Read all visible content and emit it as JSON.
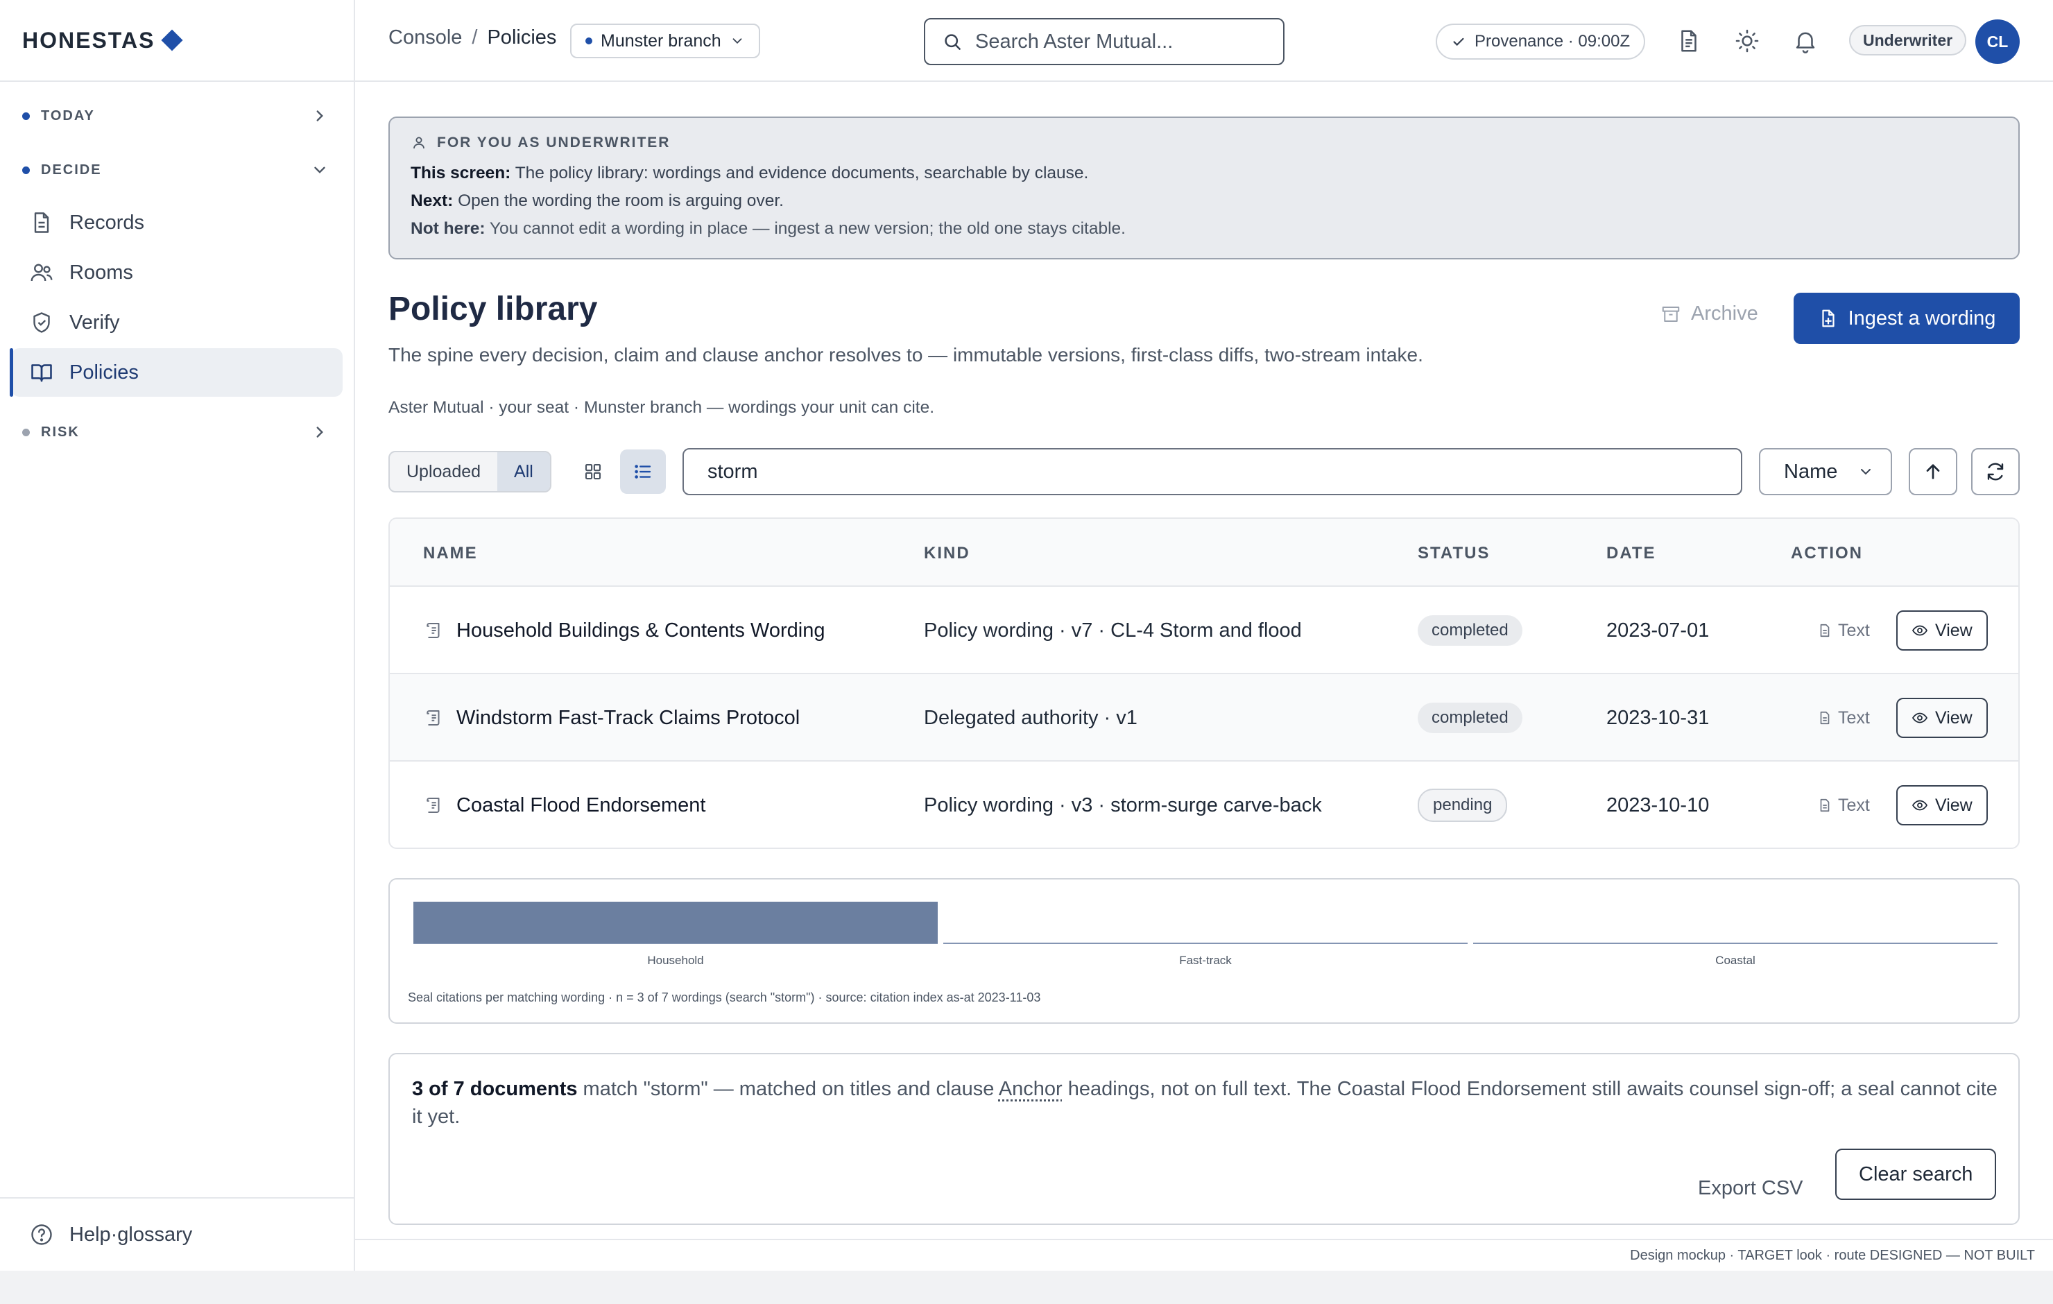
{
  "brand": {
    "name": "HONESTAS"
  },
  "sidebar": {
    "sections": [
      {
        "label": "TODAY"
      },
      {
        "label": "DECIDE"
      },
      {
        "label": "RISK"
      }
    ],
    "items": [
      {
        "label": "Records",
        "icon": "file-icon"
      },
      {
        "label": "Rooms",
        "icon": "users-icon"
      },
      {
        "label": "Verify",
        "icon": "shield-check-icon"
      },
      {
        "label": "Policies",
        "icon": "book-icon",
        "active": true
      }
    ],
    "help": "Help·glossary"
  },
  "topbar": {
    "breadcrumb": {
      "root": "Console",
      "separator": "/",
      "current": "Policies"
    },
    "branch": "Munster branch",
    "search_placeholder": "Search Aster Mutual...",
    "provenance": "Provenance · 09:00Z",
    "role": "Underwriter",
    "avatar": "CL"
  },
  "callout": {
    "heading": "FOR YOU AS UNDERWRITER",
    "lines": [
      {
        "label": "This screen:",
        "text": " The policy library: wordings and evidence documents, searchable by clause."
      },
      {
        "label": "Next:",
        "text": " Open the wording the room is arguing over."
      },
      {
        "label": "Not here:",
        "text": " You cannot edit a wording in place — ingest a new version; the old one stays citable."
      }
    ]
  },
  "page": {
    "title": "Policy library",
    "subtitle": "The spine every decision, claim and clause anchor resolves to — immutable versions, first-class diffs, two-stream intake.",
    "seat_line": "Aster Mutual · your seat · Munster branch — wordings your unit can cite.",
    "archive_label": "Archive",
    "ingest_label": "Ingest a wording"
  },
  "toolbar": {
    "segments": [
      "Uploaded",
      "All"
    ],
    "active_segment": "All",
    "view_mode": "list",
    "filter_value": "storm",
    "sort_label": "Name",
    "sort_direction": "ascending"
  },
  "table": {
    "headers": {
      "name": "NAME",
      "kind": "KIND",
      "status": "STATUS",
      "date": "DATE",
      "action": "ACTION"
    },
    "rows": [
      {
        "name": "Household Buildings & Contents Wording",
        "kind": "Policy wording · v7 · CL-4 Storm and flood",
        "status": "completed",
        "date": "2023-07-01",
        "text_label": "Text",
        "view_label": "View"
      },
      {
        "name": "Windstorm Fast-Track Claims Protocol",
        "kind": "Delegated authority · v1",
        "status": "completed",
        "date": "2023-10-31",
        "text_label": "Text",
        "view_label": "View"
      },
      {
        "name": "Coastal Flood Endorsement",
        "kind": "Policy wording · v3 · storm-surge carve-back",
        "status": "pending",
        "date": "2023-10-10",
        "text_label": "Text",
        "view_label": "View"
      }
    ]
  },
  "chart_data": {
    "type": "bar",
    "categories": [
      "Household",
      "Fast-track",
      "Coastal"
    ],
    "values": [
      1,
      0,
      0
    ],
    "ylim": [
      0,
      1
    ],
    "note": "Seal citations per matching wording · n = 3 of 7 wordings (search \"storm\") · source: citation index as-at 2023-11-03",
    "bar_color": "#6b7fa0",
    "baseline_color": "#8495b3",
    "grid": false
  },
  "summary": {
    "count": "3 of 7 documents",
    "text_a": " match \"storm\" — matched on titles and clause ",
    "anchor": "Anchor",
    "text_b": " headings, not on full text. The Coastal Flood Endorsement still awaits counsel sign-off; a seal cannot cite it yet.",
    "export_label": "Export CSV",
    "clear_label": "Clear search"
  },
  "footer": "Design mockup · TARGET look · route DESIGNED — NOT BUILT",
  "colors": {
    "accent": "#1f4fa8",
    "callout_bg": "#e9ebef"
  }
}
